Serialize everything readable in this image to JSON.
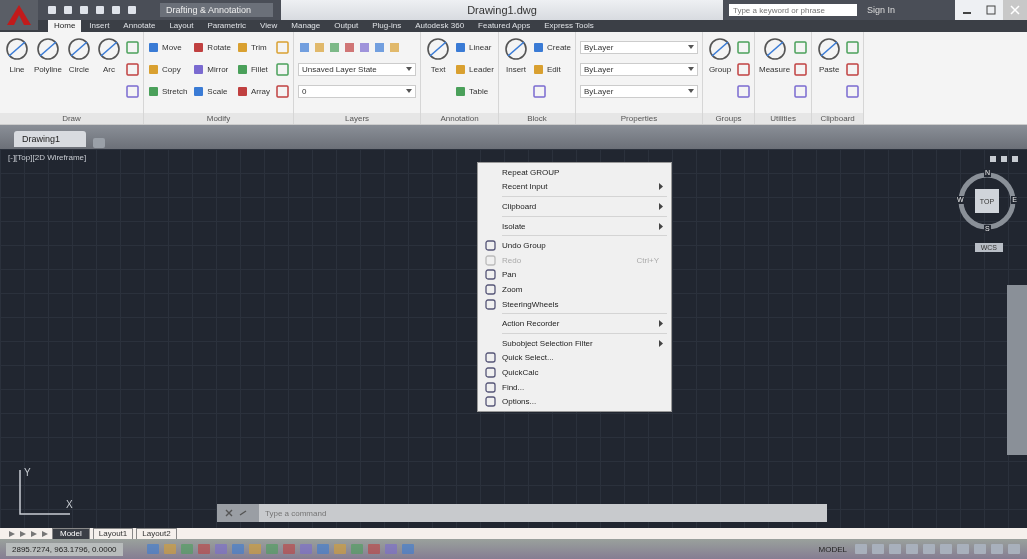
{
  "title_bar": {
    "workspace": "Drafting & Annotation",
    "title": "Drawing1.dwg",
    "search": {
      "placeholder": "Type a keyword or phrase"
    },
    "sign_in": "Sign In"
  },
  "ribbon_tabs": [
    {
      "label": "Home",
      "selected": true
    },
    {
      "label": "Insert",
      "selected": false
    },
    {
      "label": "Annotate",
      "selected": false
    },
    {
      "label": "Layout",
      "selected": false
    },
    {
      "label": "Parametric",
      "selected": false
    },
    {
      "label": "View",
      "selected": false
    },
    {
      "label": "Manage",
      "selected": false
    },
    {
      "label": "Output",
      "selected": false
    },
    {
      "label": "Plug-ins",
      "selected": false
    },
    {
      "label": "Autodesk 360",
      "selected": false
    },
    {
      "label": "Featured Apps",
      "selected": false
    },
    {
      "label": "Express Tools",
      "selected": false
    }
  ],
  "ribbon_panels": [
    {
      "title": "Draw",
      "tools": [
        {
          "kind": "large",
          "label": "Line"
        },
        {
          "kind": "large",
          "label": "Polyline"
        },
        {
          "kind": "large",
          "label": "Circle"
        },
        {
          "kind": "large",
          "label": "Arc"
        },
        {
          "kind": "icon"
        },
        {
          "kind": "icon"
        },
        {
          "kind": "icon"
        }
      ]
    },
    {
      "title": "Modify",
      "tools": [
        {
          "kind": "small",
          "label": "Move"
        },
        {
          "kind": "small",
          "label": "Copy"
        },
        {
          "kind": "small",
          "label": "Stretch"
        },
        {
          "kind": "small",
          "label": "Rotate"
        },
        {
          "kind": "small",
          "label": "Mirror"
        },
        {
          "kind": "small",
          "label": "Scale"
        },
        {
          "kind": "small",
          "label": "Trim"
        },
        {
          "kind": "small",
          "label": "Fillet"
        },
        {
          "kind": "small",
          "label": "Array"
        },
        {
          "kind": "icon"
        },
        {
          "kind": "icon"
        },
        {
          "kind": "icon"
        }
      ]
    },
    {
      "title": "Layers",
      "tools": [
        {
          "kind": "icons"
        },
        {
          "kind": "dropdown",
          "label": "Unsaved Layer State"
        },
        {
          "kind": "dropdown",
          "label": "0"
        }
      ]
    },
    {
      "title": "Annotation",
      "tools": [
        {
          "kind": "large",
          "label": "Text"
        },
        {
          "kind": "small",
          "label": "Linear"
        },
        {
          "kind": "small",
          "label": "Leader"
        },
        {
          "kind": "small",
          "label": "Table"
        }
      ]
    },
    {
      "title": "Block",
      "tools": [
        {
          "kind": "large",
          "label": "Insert"
        },
        {
          "kind": "small",
          "label": "Create"
        },
        {
          "kind": "small",
          "label": "Edit"
        },
        {
          "kind": "icon"
        }
      ]
    },
    {
      "title": "Properties",
      "tools": [
        {
          "kind": "dropdown",
          "label": "ByLayer"
        },
        {
          "kind": "dropdown",
          "label": "ByLayer"
        },
        {
          "kind": "dropdown",
          "label": "ByLayer"
        }
      ]
    },
    {
      "title": "Groups",
      "tools": [
        {
          "kind": "large",
          "label": "Group"
        },
        {
          "kind": "icon"
        },
        {
          "kind": "icon"
        },
        {
          "kind": "icon"
        }
      ]
    },
    {
      "title": "Utilities",
      "tools": [
        {
          "kind": "large",
          "label": "Measure"
        },
        {
          "kind": "icon"
        },
        {
          "kind": "icon"
        },
        {
          "kind": "icon"
        }
      ]
    },
    {
      "title": "Clipboard",
      "tools": [
        {
          "kind": "large",
          "label": "Paste"
        },
        {
          "kind": "icon"
        },
        {
          "kind": "icon"
        },
        {
          "kind": "icon"
        }
      ]
    }
  ],
  "file_tabs": [
    {
      "label": "Drawing1",
      "selected": true
    }
  ],
  "viewport": {
    "label": "[-][Top][2D Wireframe]",
    "viewcube": {
      "top": "TOP",
      "north": "N",
      "south": "S",
      "east": "E",
      "west": "W",
      "ucs": "WCS"
    },
    "ucs_icon": {
      "x": "X",
      "y": "Y"
    }
  },
  "context_menu": [
    {
      "kind": "item",
      "label": "Repeat GROUP",
      "icon": false,
      "submenu": false,
      "disabled": false
    },
    {
      "kind": "item",
      "label": "Recent Input",
      "icon": false,
      "submenu": true,
      "disabled": false
    },
    {
      "kind": "separator"
    },
    {
      "kind": "item",
      "label": "Clipboard",
      "icon": false,
      "submenu": true,
      "disabled": false
    },
    {
      "kind": "separator"
    },
    {
      "kind": "item",
      "label": "Isolate",
      "icon": false,
      "submenu": true,
      "disabled": false
    },
    {
      "kind": "separator"
    },
    {
      "kind": "item",
      "label": "Undo Group",
      "icon": true,
      "submenu": false,
      "disabled": false
    },
    {
      "kind": "item",
      "label": "Redo",
      "icon": true,
      "submenu": false,
      "disabled": true,
      "shortcut": "Ctrl+Y"
    },
    {
      "kind": "item",
      "label": "Pan",
      "icon": true,
      "submenu": false,
      "disabled": false
    },
    {
      "kind": "item",
      "label": "Zoom",
      "icon": true,
      "submenu": false,
      "disabled": false
    },
    {
      "kind": "item",
      "label": "SteeringWheels",
      "icon": true,
      "submenu": false,
      "disabled": false
    },
    {
      "kind": "separator"
    },
    {
      "kind": "item",
      "label": "Action Recorder",
      "icon": false,
      "submenu": true,
      "disabled": false
    },
    {
      "kind": "separator"
    },
    {
      "kind": "item",
      "label": "Subobject Selection Filter",
      "icon": false,
      "submenu": true,
      "disabled": false
    },
    {
      "kind": "item",
      "label": "Quick Select...",
      "icon": true,
      "submenu": false,
      "disabled": false
    },
    {
      "kind": "item",
      "label": "QuickCalc",
      "icon": true,
      "submenu": false,
      "disabled": false
    },
    {
      "kind": "item",
      "label": "Find...",
      "icon": true,
      "submenu": false,
      "disabled": false
    },
    {
      "kind": "item",
      "label": "Options...",
      "icon": true,
      "submenu": false,
      "disabled": false
    }
  ],
  "command_line": {
    "placeholder": "Type a command"
  },
  "layout_tabs": [
    {
      "kind": "model",
      "label": "Model",
      "selected": true
    },
    {
      "kind": "layout",
      "label": "Layout1",
      "selected": false
    },
    {
      "kind": "layout",
      "label": "Layout2",
      "selected": false
    }
  ],
  "status_bar": {
    "coordinates": "2895.7274, 963.1796, 0.0000",
    "model": "MODEL"
  }
}
